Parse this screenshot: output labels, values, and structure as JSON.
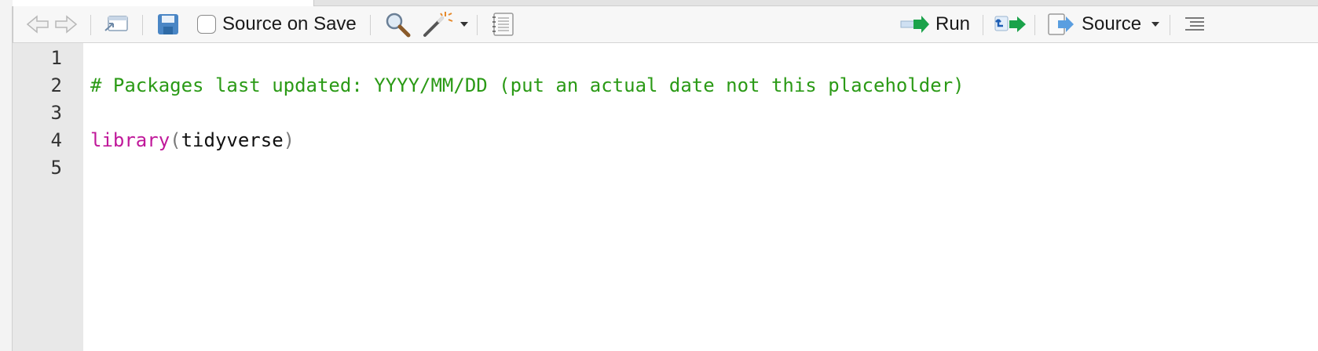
{
  "toolbar": {
    "source_on_save_label": "Source on Save",
    "run_label": "Run",
    "source_label": "Source",
    "icons": [
      "back-arrow-icon",
      "forward-arrow-icon",
      "show-in-window-icon",
      "save-icon",
      "search-icon",
      "magic-wand-icon",
      "dropdown-caret-icon",
      "notebook-icon",
      "run-arrow-icon",
      "rerun-icon",
      "source-icon",
      "outline-icon"
    ],
    "source_on_save_checked": false
  },
  "editor": {
    "line_numbers": [
      "1",
      "2",
      "3",
      "4",
      "5"
    ],
    "lines": {
      "line2_comment": "# Packages last updated: YYYY/MM/DD (put an actual date not this placeholder)",
      "line4_function": "library",
      "line4_open_paren": "(",
      "line4_arg": "tidyverse",
      "line4_close_paren": ")"
    }
  },
  "colors": {
    "comment": "#2b9a16",
    "keyword": "#c0189a",
    "run_arrow": "#1aa24a",
    "save_icon": "#4a86c5"
  }
}
